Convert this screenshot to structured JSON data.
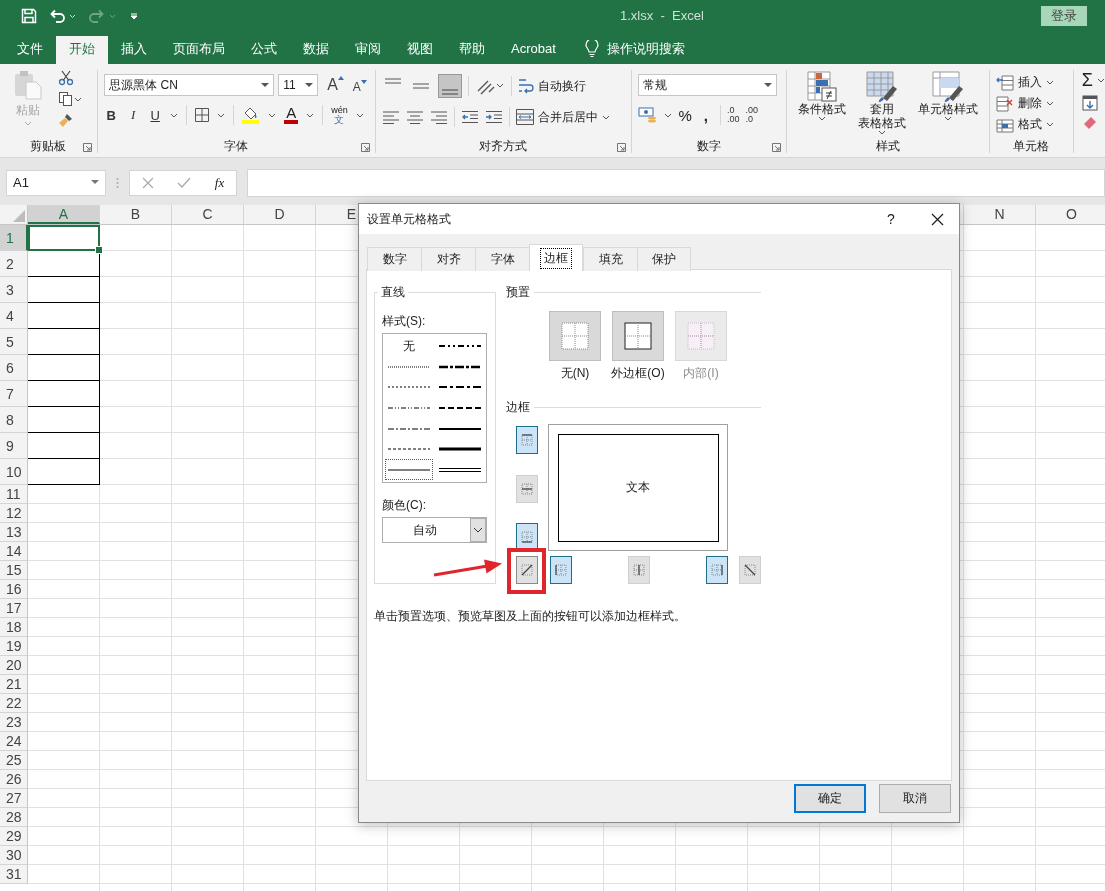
{
  "title_bar": {
    "file_title": "1.xlsx  -  Excel",
    "sign_in": "登录"
  },
  "menu_tabs": [
    {
      "label": "文件",
      "selected": false
    },
    {
      "label": "开始",
      "selected": true
    },
    {
      "label": "插入",
      "selected": false
    },
    {
      "label": "页面布局",
      "selected": false
    },
    {
      "label": "公式",
      "selected": false
    },
    {
      "label": "数据",
      "selected": false
    },
    {
      "label": "审阅",
      "selected": false
    },
    {
      "label": "视图",
      "selected": false
    },
    {
      "label": "帮助",
      "selected": false
    },
    {
      "label": "Acrobat",
      "selected": false
    }
  ],
  "tell_me": "操作说明搜索",
  "ribbon": {
    "clipboard": {
      "paste": "粘贴",
      "paste_disabled": true,
      "label": "剪贴板"
    },
    "font": {
      "font_name": "思源黑体 CN",
      "font_size": "11",
      "grow": "A",
      "shrink": "A",
      "bold": "B",
      "italic": "I",
      "underline": "U",
      "font_color": "A",
      "phonetic_top": "wén",
      "phonetic_bottom": "文",
      "label": "字体"
    },
    "alignment": {
      "wrap_text": "自动换行",
      "merge": "合并后居中",
      "label": "对齐方式"
    },
    "number": {
      "format": "常规",
      "percent": "%",
      "comma": ",",
      "increase_decimal": [
        ".0",
        ".00"
      ],
      "decrease_decimal": [
        ".00",
        ".0"
      ],
      "label": "数字"
    },
    "styles": {
      "buttons": [
        {
          "kind": "conditional",
          "lines": [
            "条件格式"
          ]
        },
        {
          "kind": "table",
          "lines": [
            "套用",
            "表格格式"
          ]
        },
        {
          "kind": "cell",
          "lines": [
            "单元格样式"
          ]
        }
      ],
      "label": "样式"
    },
    "cells": {
      "items": [
        {
          "kind": "insert",
          "label": "插入"
        },
        {
          "kind": "delete",
          "label": "删除"
        },
        {
          "kind": "format",
          "label": "格式"
        }
      ],
      "label": "单元格"
    },
    "editing": {
      "autosum": "Σ"
    }
  },
  "formula_bar": {
    "name_box": "A1",
    "fx": "fx"
  },
  "sheet": {
    "columns_left": [
      {
        "label": "A",
        "selected": true
      },
      {
        "label": "B",
        "selected": false
      },
      {
        "label": "C",
        "selected": false
      },
      {
        "label": "D",
        "selected": false
      },
      {
        "label": "E",
        "selected": false
      }
    ],
    "columns_right": [
      {
        "label": "N",
        "selected": false
      },
      {
        "label": "O",
        "selected": false
      }
    ],
    "rows": [
      {
        "label": "1",
        "selected": true,
        "a_bordered": true
      },
      {
        "label": "2",
        "selected": false,
        "a_bordered": true
      },
      {
        "label": "3",
        "selected": false,
        "a_bordered": true
      },
      {
        "label": "4",
        "selected": false,
        "a_bordered": true
      },
      {
        "label": "5",
        "selected": false,
        "a_bordered": true
      },
      {
        "label": "6",
        "selected": false,
        "a_bordered": true
      },
      {
        "label": "7",
        "selected": false,
        "a_bordered": true
      },
      {
        "label": "8",
        "selected": false,
        "a_bordered": true
      },
      {
        "label": "9",
        "selected": false,
        "a_bordered": true
      },
      {
        "label": "10",
        "selected": false,
        "a_bordered": true
      },
      {
        "label": "11",
        "selected": false,
        "a_bordered": false
      },
      {
        "label": "12",
        "selected": false,
        "a_bordered": false
      },
      {
        "label": "13",
        "selected": false,
        "a_bordered": false
      },
      {
        "label": "14",
        "selected": false,
        "a_bordered": false
      },
      {
        "label": "15",
        "selected": false,
        "a_bordered": false
      },
      {
        "label": "16",
        "selected": false,
        "a_bordered": false
      },
      {
        "label": "17",
        "selected": false,
        "a_bordered": false
      },
      {
        "label": "18",
        "selected": false,
        "a_bordered": false
      },
      {
        "label": "19",
        "selected": false,
        "a_bordered": false
      },
      {
        "label": "20",
        "selected": false,
        "a_bordered": false
      },
      {
        "label": "21",
        "selected": false,
        "a_bordered": false
      },
      {
        "label": "22",
        "selected": false,
        "a_bordered": false
      },
      {
        "label": "23",
        "selected": false,
        "a_bordered": false
      },
      {
        "label": "24",
        "selected": false,
        "a_bordered": false
      },
      {
        "label": "25",
        "selected": false,
        "a_bordered": false
      },
      {
        "label": "26",
        "selected": false,
        "a_bordered": false
      },
      {
        "label": "27",
        "selected": false,
        "a_bordered": false
      },
      {
        "label": "28",
        "selected": false,
        "a_bordered": false
      },
      {
        "label": "29",
        "selected": false,
        "a_bordered": false
      },
      {
        "label": "30",
        "selected": false,
        "a_bordered": false
      },
      {
        "label": "31",
        "selected": false,
        "a_bordered": false
      }
    ]
  },
  "dialog": {
    "title": "设置单元格格式",
    "help": "?",
    "tabs": [
      {
        "label": "数字",
        "selected": false
      },
      {
        "label": "对齐",
        "selected": false
      },
      {
        "label": "字体",
        "selected": false
      },
      {
        "label": "边框",
        "selected": true
      },
      {
        "label": "填充",
        "selected": false
      },
      {
        "label": "保护",
        "selected": false
      }
    ],
    "line_group": {
      "title": "直线",
      "style_label": "样式(S):",
      "styles": [
        {
          "kind": "none",
          "label": "无",
          "selected": false
        },
        {
          "kind": "hair",
          "selected": false
        },
        {
          "kind": "dotted",
          "selected": false
        },
        {
          "kind": "dashdotdot",
          "selected": false
        },
        {
          "kind": "dashdot",
          "selected": false
        },
        {
          "kind": "dashed",
          "selected": false
        },
        {
          "kind": "thin",
          "selected": true
        },
        {
          "kind": "medium_dashdotdot",
          "selected": false
        },
        {
          "kind": "slant_dashdot",
          "selected": false
        },
        {
          "kind": "medium_dashdot",
          "selected": false
        },
        {
          "kind": "medium_dashed",
          "selected": false
        },
        {
          "kind": "medium",
          "selected": false
        },
        {
          "kind": "thick",
          "selected": false
        },
        {
          "kind": "double",
          "selected": false
        }
      ],
      "color_label": "颜色(C):",
      "color_choice": "自动"
    },
    "presets_title": "预置",
    "presets": [
      {
        "kind": "none",
        "label": "无(N)",
        "disabled": false
      },
      {
        "kind": "outline",
        "label": "外边框(O)",
        "disabled": false
      },
      {
        "kind": "inside",
        "label": "内部(I)",
        "disabled": true
      }
    ],
    "border_title": "边框",
    "preview_text": "文本",
    "border_buttons": [
      {
        "kind": "top",
        "on": true,
        "highlighted": false
      },
      {
        "kind": "middle_h",
        "on": false,
        "highlighted": false
      },
      {
        "kind": "bottom",
        "on": true,
        "highlighted": false
      },
      {
        "kind": "diag_up",
        "on": false,
        "highlighted": true
      },
      {
        "kind": "left",
        "on": true,
        "highlighted": false
      },
      {
        "kind": "middle_v",
        "on": false,
        "highlighted": false
      },
      {
        "kind": "right",
        "on": true,
        "highlighted": false
      },
      {
        "kind": "diag_down",
        "on": false,
        "highlighted": false
      }
    ],
    "hint": "单击预置选项、预览草图及上面的按钮可以添加边框样式。",
    "buttons": [
      {
        "label": "确定",
        "default": true
      },
      {
        "label": "取消",
        "default": false
      }
    ]
  }
}
